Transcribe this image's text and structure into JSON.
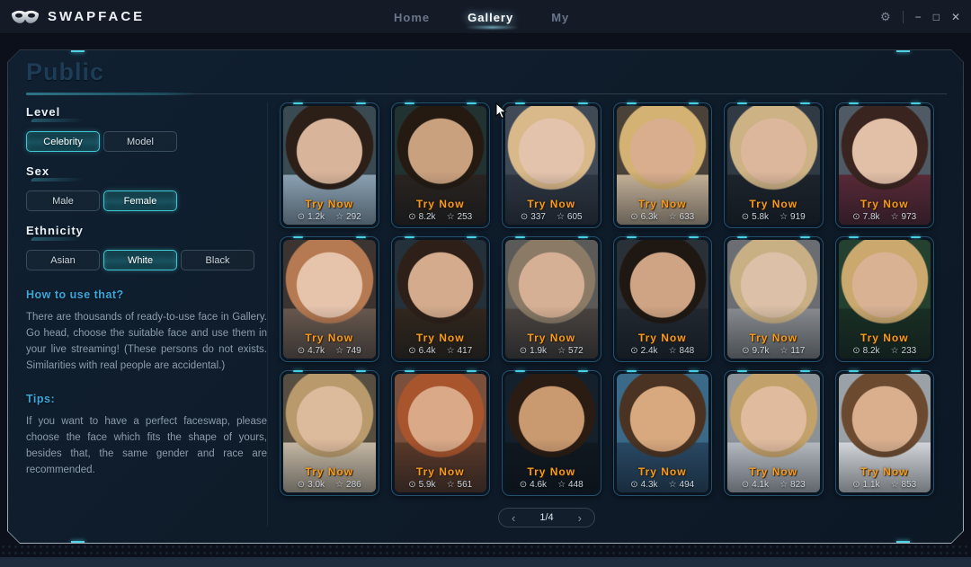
{
  "app": {
    "title": "SWAPFACE",
    "nav": [
      {
        "label": "Home",
        "active": false
      },
      {
        "label": "Gallery",
        "active": true
      },
      {
        "label": "My",
        "active": false
      }
    ],
    "window": {
      "settings_icon": "⚙",
      "minimize_icon": "−",
      "maximize_icon": "□",
      "close_icon": "✕"
    }
  },
  "page": {
    "title": "Public"
  },
  "filters": {
    "level": {
      "label": "Level",
      "options": [
        {
          "label": "Celebrity",
          "selected": true
        },
        {
          "label": "Model",
          "selected": false
        }
      ]
    },
    "sex": {
      "label": "Sex",
      "options": [
        {
          "label": "Male",
          "selected": false
        },
        {
          "label": "Female",
          "selected": true
        }
      ]
    },
    "ethnicity": {
      "label": "Ethnicity",
      "options": [
        {
          "label": "Asian",
          "selected": false
        },
        {
          "label": "White",
          "selected": true
        },
        {
          "label": "Black",
          "selected": false
        }
      ]
    }
  },
  "help": {
    "howto_title": "How to use that?",
    "howto_text": "There are thousands of ready-to-use face in Gallery. Go head, choose the suitable face and use them in your live streaming! (These persons do not exists. Similarities with real people are accidental.)",
    "tips_title": "Tips:",
    "tips_text": "If you want to have a perfect faceswap, please choose the face which fits the shape of yours, besides that, the same gender and race are recommended."
  },
  "gallery": {
    "try_label": "Try Now",
    "views_icon": "⊙",
    "stars_icon": "☆",
    "cards": [
      {
        "views": "1.2k",
        "stars": "292",
        "photo": {
          "hair": "#2b1f18",
          "skin": "#d8b49a",
          "bg": "#3a4a52",
          "top": "#8fa6b8"
        }
      },
      {
        "views": "8.2k",
        "stars": "253",
        "photo": {
          "hair": "#241a12",
          "skin": "#caa17f",
          "bg": "#223230",
          "top": "#2a2420"
        }
      },
      {
        "views": "337",
        "stars": "605",
        "photo": {
          "hair": "#d9b98a",
          "skin": "#e3c3ac",
          "bg": "#3f4a56",
          "top": "#2e3642"
        }
      },
      {
        "views": "6.3k",
        "stars": "633",
        "photo": {
          "hair": "#d3b273",
          "skin": "#d9ae8e",
          "bg": "#4a4238",
          "top": "#c8b49a"
        }
      },
      {
        "views": "5.8k",
        "stars": "919",
        "photo": {
          "hair": "#cdb285",
          "skin": "#dcb79c",
          "bg": "#2f3a44",
          "top": "#1d242c"
        }
      },
      {
        "views": "7.8k",
        "stars": "973",
        "photo": {
          "hair": "#3a2420",
          "skin": "#e2c0a8",
          "bg": "#4f5a64",
          "top": "#5a2a38"
        }
      },
      {
        "views": "4.7k",
        "stars": "749",
        "photo": {
          "hair": "#b6潜7a52",
          "skin": "#e6c4ac",
          "bg": "#3c3430",
          "top": "#6a5a50"
        }
      },
      {
        "views": "6.4k",
        "stars": "417",
        "photo": {
          "hair": "#2e2019",
          "skin": "#d4ab8c",
          "bg": "#24303a",
          "top": "#32281e"
        }
      },
      {
        "views": "1.9k",
        "stars": "572",
        "photo": {
          "hair": "#8a7a66",
          "skin": "#d6b094",
          "bg": "#5a5a58",
          "top": "#4a4440"
        }
      },
      {
        "views": "2.4k",
        "stars": "848",
        "photo": {
          "hair": "#1f1812",
          "skin": "#cfa484",
          "bg": "#2a3038",
          "top": "#222830"
        }
      },
      {
        "views": "9.7k",
        "stars": "117",
        "photo": {
          "hair": "#c9b084",
          "skin": "#dcc0a8",
          "bg": "#6a6e72",
          "top": "#8a8e92"
        }
      },
      {
        "views": "8.2k",
        "stars": "233",
        "photo": {
          "hair": "#caa86e",
          "skin": "#d9b294",
          "bg": "#24402e",
          "top": "#1a3024"
        }
      },
      {
        "views": "3.0k",
        "stars": "286",
        "photo": {
          "hair": "#b99a6c",
          "skin": "#dcba9c",
          "bg": "#564e40",
          "top": "#cabda8"
        }
      },
      {
        "views": "5.9k",
        "stars": "561",
        "photo": {
          "hair": "#a8542c",
          "skin": "#d9a988",
          "bg": "#7a503c",
          "top": "#5a3a2a"
        }
      },
      {
        "views": "4.6k",
        "stars": "448",
        "photo": {
          "hair": "#2a1c12",
          "skin": "#c9996f",
          "bg": "#14202c",
          "top": "#101820"
        }
      },
      {
        "views": "4.3k",
        "stars": "494",
        "photo": {
          "hair": "#4a3322",
          "skin": "#d8a87e",
          "bg": "#3a6a88",
          "top": "#2a4a66"
        }
      },
      {
        "views": "4.1k",
        "stars": "823",
        "photo": {
          "hair": "#c2a16a",
          "skin": "#e0bb9e",
          "bg": "#8a9298",
          "top": "#b8bec4"
        }
      },
      {
        "views": "1.1k",
        "stars": "853",
        "photo": {
          "hair": "#6b4a30",
          "skin": "#d9af8e",
          "bg": "#9aa2a8",
          "top": "#d8dce0"
        }
      }
    ]
  },
  "pagination": {
    "prev_icon": "‹",
    "current_page": "1/4",
    "next_icon": "›"
  },
  "colors": {
    "accent_teal": "#4fd0e0",
    "try_now_orange": "#f59b1d",
    "active_nav": "#ffffff",
    "help_title_blue": "#3ba5d6",
    "panel_bg": "#0e1b29",
    "titlebar_bg": "#151a27"
  }
}
